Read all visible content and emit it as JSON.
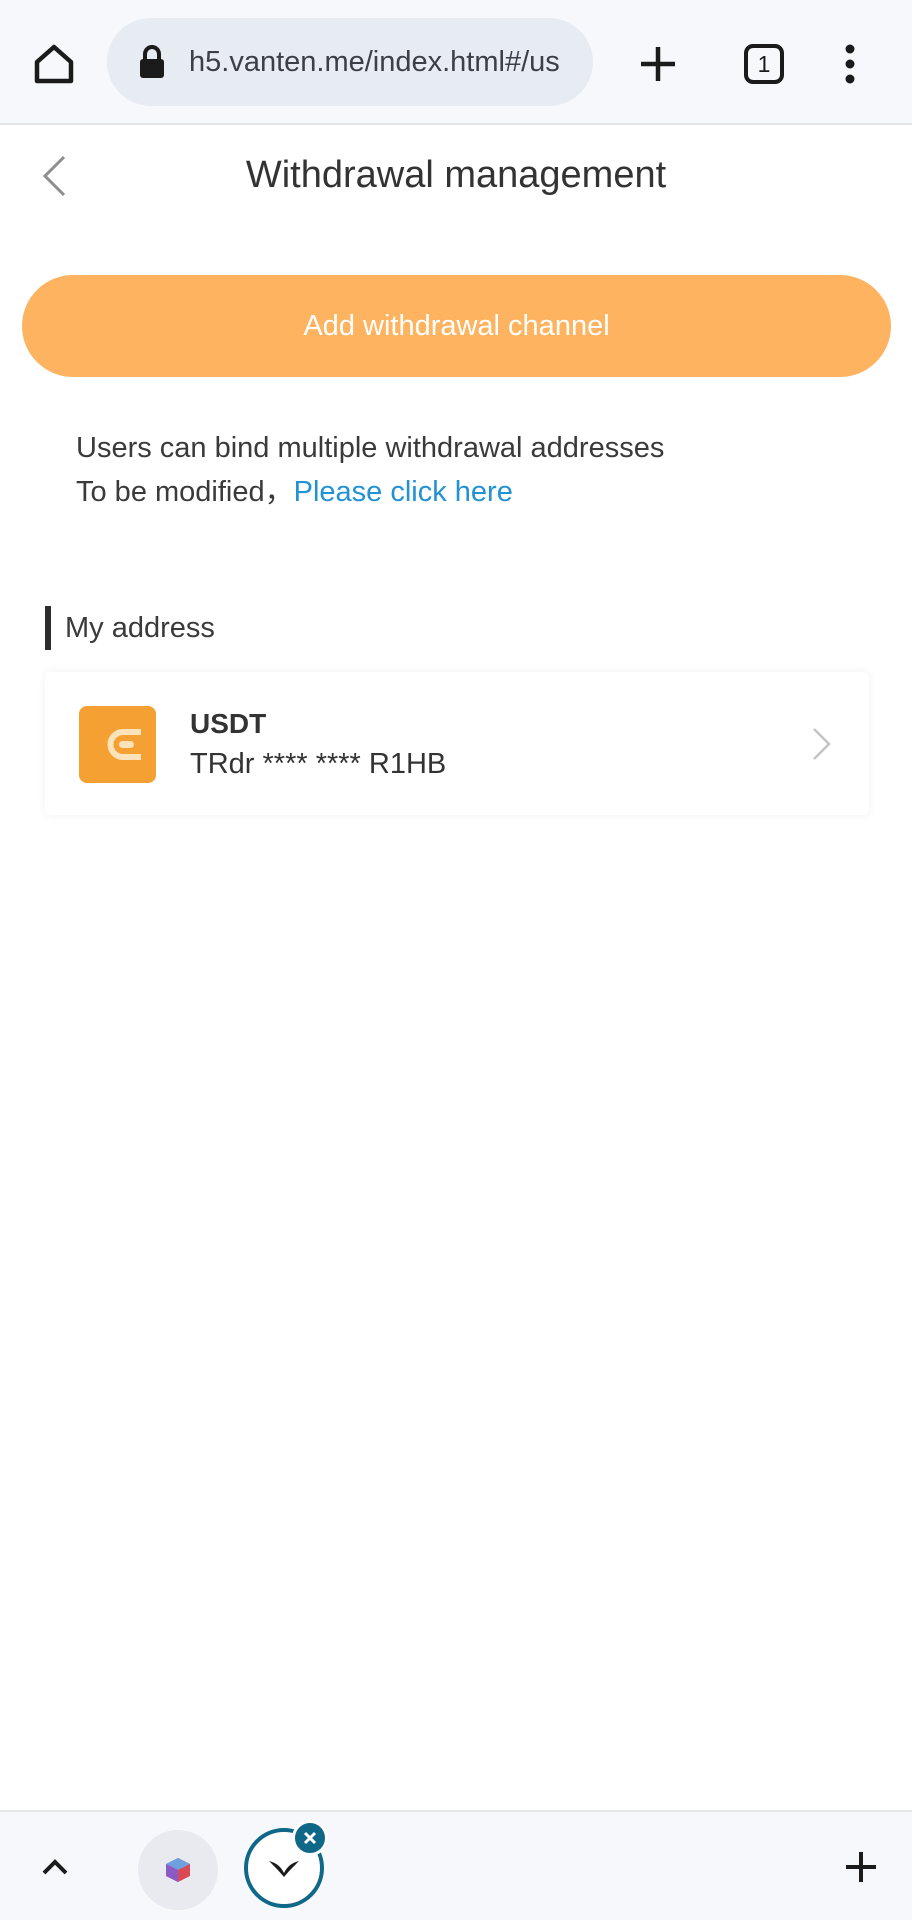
{
  "browser": {
    "url": "h5.vanten.me/index.html#/us",
    "tab_count": "1"
  },
  "header": {
    "title": "Withdrawal management"
  },
  "actions": {
    "add_channel_label": "Add withdrawal channel"
  },
  "info": {
    "line1": "Users can bind multiple withdrawal addresses",
    "line2_prefix": "To be modified，",
    "line2_link": "Please click here"
  },
  "section": {
    "title": "My address"
  },
  "addresses": [
    {
      "coin": "USDT",
      "address": "TRdr **** **** R1HB"
    }
  ],
  "colors": {
    "accent": "#fdb35f",
    "wallet": "#f5a033",
    "link": "#2192d3",
    "tab_ring": "#106889"
  }
}
